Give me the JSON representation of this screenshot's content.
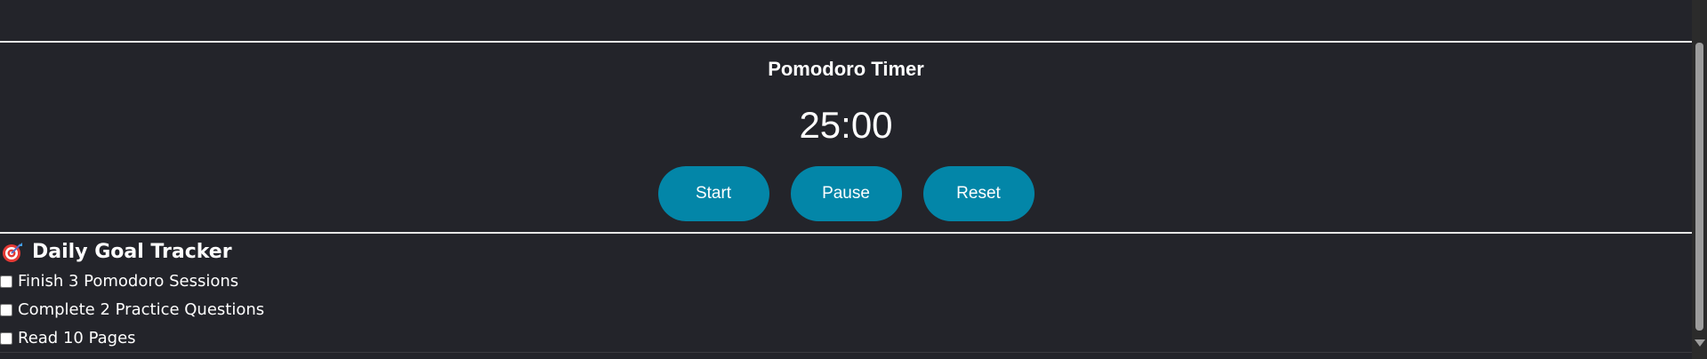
{
  "pomodoro": {
    "title": "Pomodoro Timer",
    "time": "25:00",
    "buttons": {
      "start": "Start",
      "pause": "Pause",
      "reset": "Reset"
    },
    "button_color": "#0386a8"
  },
  "goals": {
    "heading": "Daily Goal Tracker",
    "heading_icon": "target-icon",
    "items": [
      {
        "label": "Finish 3 Pomodoro Sessions",
        "checked": false
      },
      {
        "label": "Complete 2 Practice Questions",
        "checked": false
      },
      {
        "label": "Read 10 Pages",
        "checked": false
      }
    ]
  },
  "colors": {
    "background": "#23242a",
    "divider": "#e6e6e6",
    "text": "#ffffff"
  }
}
